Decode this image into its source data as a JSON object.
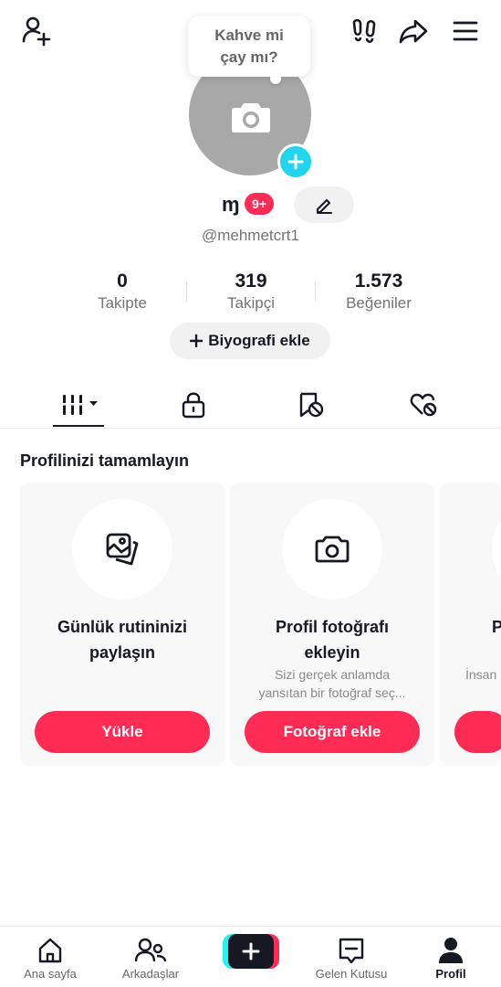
{
  "top_bar": {
    "add_friend_icon": "person-plus-icon",
    "footprints_icon": "footprints-icon",
    "share_icon": "share-arrow-icon",
    "menu_icon": "hamburger-menu-icon"
  },
  "avatar": {
    "bubble_line1": "Kahve mi",
    "bubble_line2": "çay mı?",
    "camera_icon": "camera-icon",
    "add_icon": "plus-icon"
  },
  "profile": {
    "name": "ɱ",
    "badge": "9+",
    "handle": "@mehmetcrt1",
    "edit_icon": "pencil-icon"
  },
  "stats": [
    {
      "value": "0",
      "label": "Takipte"
    },
    {
      "value": "319",
      "label": "Takipçi"
    },
    {
      "value": "1.573",
      "label": "Beğeniler"
    }
  ],
  "bio_button": {
    "label": "Biyografi ekle",
    "icon": "plus-icon"
  },
  "tabs": [
    "videos-grid-icon",
    "lock-icon",
    "bookmark-hidden-icon",
    "liked-hidden-icon"
  ],
  "complete_profile": {
    "title": "Profilinizi tamamlayın",
    "cards": [
      {
        "title_line1": "Günlük rutininizi",
        "title_line2": "paylaşın",
        "desc_line1": "",
        "desc_line2": "",
        "button": "Yükle",
        "icon": "photos-icon"
      },
      {
        "title_line1": "Profil fotoğrafı",
        "title_line2": "ekleyin",
        "desc_line1": "Sizi gerçek anlamda",
        "desc_line2": "yansıtan bir fotoğraf seç...",
        "button": "Fotoğraf ekle",
        "icon": "camera-icon"
      },
      {
        "title_line1": "Pr",
        "title_line2": "",
        "desc_line1": "İnsan",
        "desc_line2": "",
        "button": "",
        "icon": ""
      }
    ]
  },
  "bottom_nav": {
    "items": [
      {
        "label": "Ana sayfa",
        "icon": "home-icon"
      },
      {
        "label": "Arkadaşlar",
        "icon": "friends-icon"
      },
      {
        "label": "Gelen Kutusu",
        "icon": "inbox-icon"
      },
      {
        "label": "Profil",
        "icon": "profile-icon"
      }
    ],
    "create_icon": "plus-icon"
  },
  "colors": {
    "accent": "#fe2c55",
    "cyan": "#20d5ec",
    "text": "#161823",
    "muted": "#737373"
  }
}
